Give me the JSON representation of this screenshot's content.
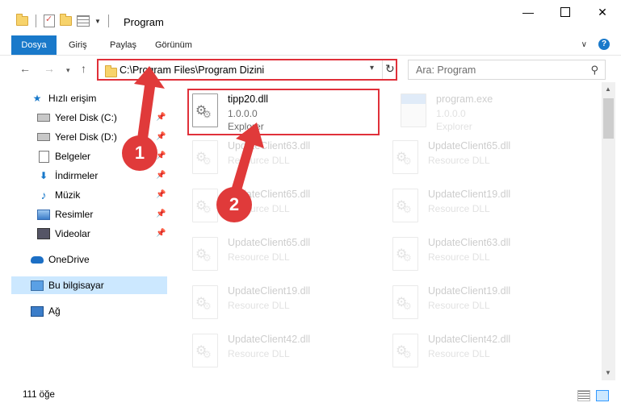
{
  "window": {
    "title": "Program",
    "controls": {
      "minimize": "—",
      "close": "✕"
    }
  },
  "ribbon": {
    "tabs": [
      {
        "label": "Dosya"
      },
      {
        "label": "Giriş"
      },
      {
        "label": "Paylaş"
      },
      {
        "label": "Görünüm"
      }
    ],
    "help": "?"
  },
  "nav": {
    "back": "←",
    "forward": "→",
    "recent": "▾",
    "up": "↑",
    "address": "C:\\Program Files\\Program Dizini",
    "address_dropdown": "▾",
    "refresh": "↻",
    "search_placeholder": "Ara: Program",
    "search_icon": "⚲"
  },
  "sidebar": {
    "items": [
      {
        "label": "Hızlı erişim",
        "icon": "star-icon"
      },
      {
        "label": "Yerel Disk (C:)",
        "icon": "disk-icon",
        "pinned": true
      },
      {
        "label": "Yerel Disk (D:)",
        "icon": "disk-icon",
        "pinned": true
      },
      {
        "label": "Belgeler",
        "icon": "documents-icon",
        "pinned": true
      },
      {
        "label": "İndirmeler",
        "icon": "download-icon",
        "pinned": true
      },
      {
        "label": "Müzik",
        "icon": "music-icon",
        "pinned": true
      },
      {
        "label": "Resimler",
        "icon": "pictures-icon",
        "pinned": true
      },
      {
        "label": "Videolar",
        "icon": "video-icon",
        "pinned": true
      },
      {
        "label": "OneDrive",
        "icon": "cloud-icon"
      },
      {
        "label": "Bu bilgisayar",
        "icon": "computer-icon",
        "selected": true
      },
      {
        "label": "Ağ",
        "icon": "network-icon"
      }
    ],
    "pin_glyph": "📌"
  },
  "files": [
    {
      "name": "tipp20.dll",
      "line2": "1.0.0.0",
      "line3": "Explorer",
      "highlighted": true
    },
    {
      "name": "program.exe",
      "line2": "1.0.0.0",
      "line3": "Explorer",
      "type": "exe"
    },
    {
      "name": "UpdateClient63.dll",
      "line2": "Resource DLL"
    },
    {
      "name": "UpdateClient65.dll",
      "line2": "Resource DLL"
    },
    {
      "name": "UpdateClient65.dll",
      "line2": "Resource DLL"
    },
    {
      "name": "UpdateClient19.dll",
      "line2": "Resource DLL"
    },
    {
      "name": "UpdateClient65.dll",
      "line2": "Resource DLL"
    },
    {
      "name": "UpdateClient63.dll",
      "line2": "Resource DLL"
    },
    {
      "name": "UpdateClient19.dll",
      "line2": "Resource DLL"
    },
    {
      "name": "UpdateClient19.dll",
      "line2": "Resource DLL"
    },
    {
      "name": "UpdateClient42.dll",
      "line2": "Resource DLL"
    },
    {
      "name": "UpdateClient42.dll",
      "line2": "Resource DLL"
    }
  ],
  "scrollbar": {
    "up": "▲",
    "down": "▼"
  },
  "status": {
    "item_count": "111 öğe"
  },
  "annotations": {
    "callout1": "1",
    "callout2": "2",
    "accent": "#e03a3a"
  }
}
